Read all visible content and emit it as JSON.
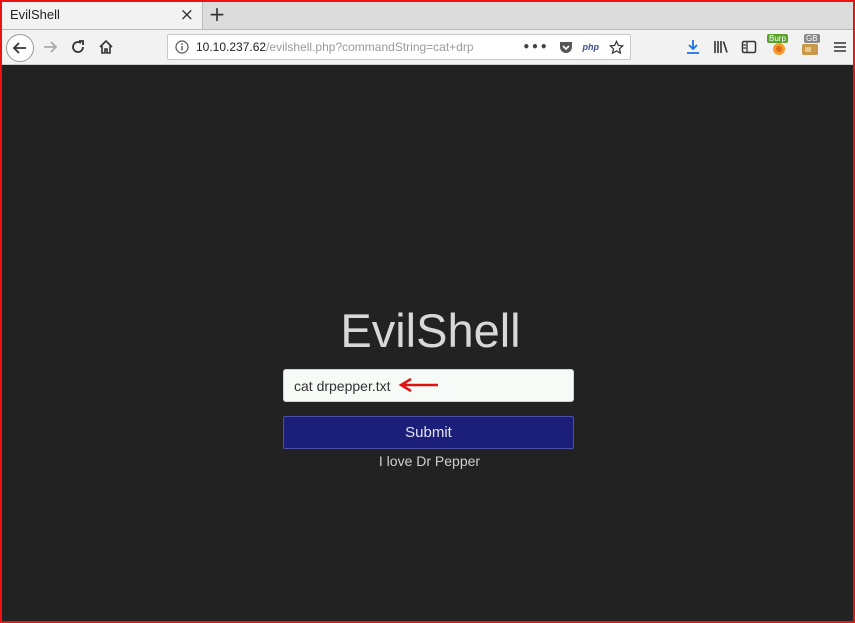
{
  "browser": {
    "tab_title": "EvilShell",
    "tab_close": "×",
    "new_tab": "+",
    "url_host": "10.10.237.62",
    "url_path": "/evilshell.php?commandString=cat+drp",
    "dots": "•••",
    "php_label": "php",
    "burp_badge": "Burp",
    "gb_badge": "GB",
    "colors": {
      "accent_download": "#1a73e8",
      "burp_badge": "#5aa02c",
      "gb_badge": "#888888"
    }
  },
  "page": {
    "title": "EvilShell",
    "command_value": "cat drpepper.txt",
    "submit_label": "Submit",
    "output": "I love Dr Pepper",
    "colors": {
      "background": "#222222",
      "button": "#1b1f7a",
      "annotation_arrow": "#e11111",
      "frame": "#e11111"
    }
  },
  "icons": [
    "back-arrow-icon",
    "forward-arrow-icon",
    "reload-icon",
    "home-icon",
    "info-icon",
    "pocket-icon",
    "star-icon",
    "download-icon",
    "library-icon",
    "sidebar-icon",
    "burp-extension-icon",
    "gb-extension-icon",
    "hamburger-menu-icon",
    "red-arrow-annotation-icon"
  ]
}
